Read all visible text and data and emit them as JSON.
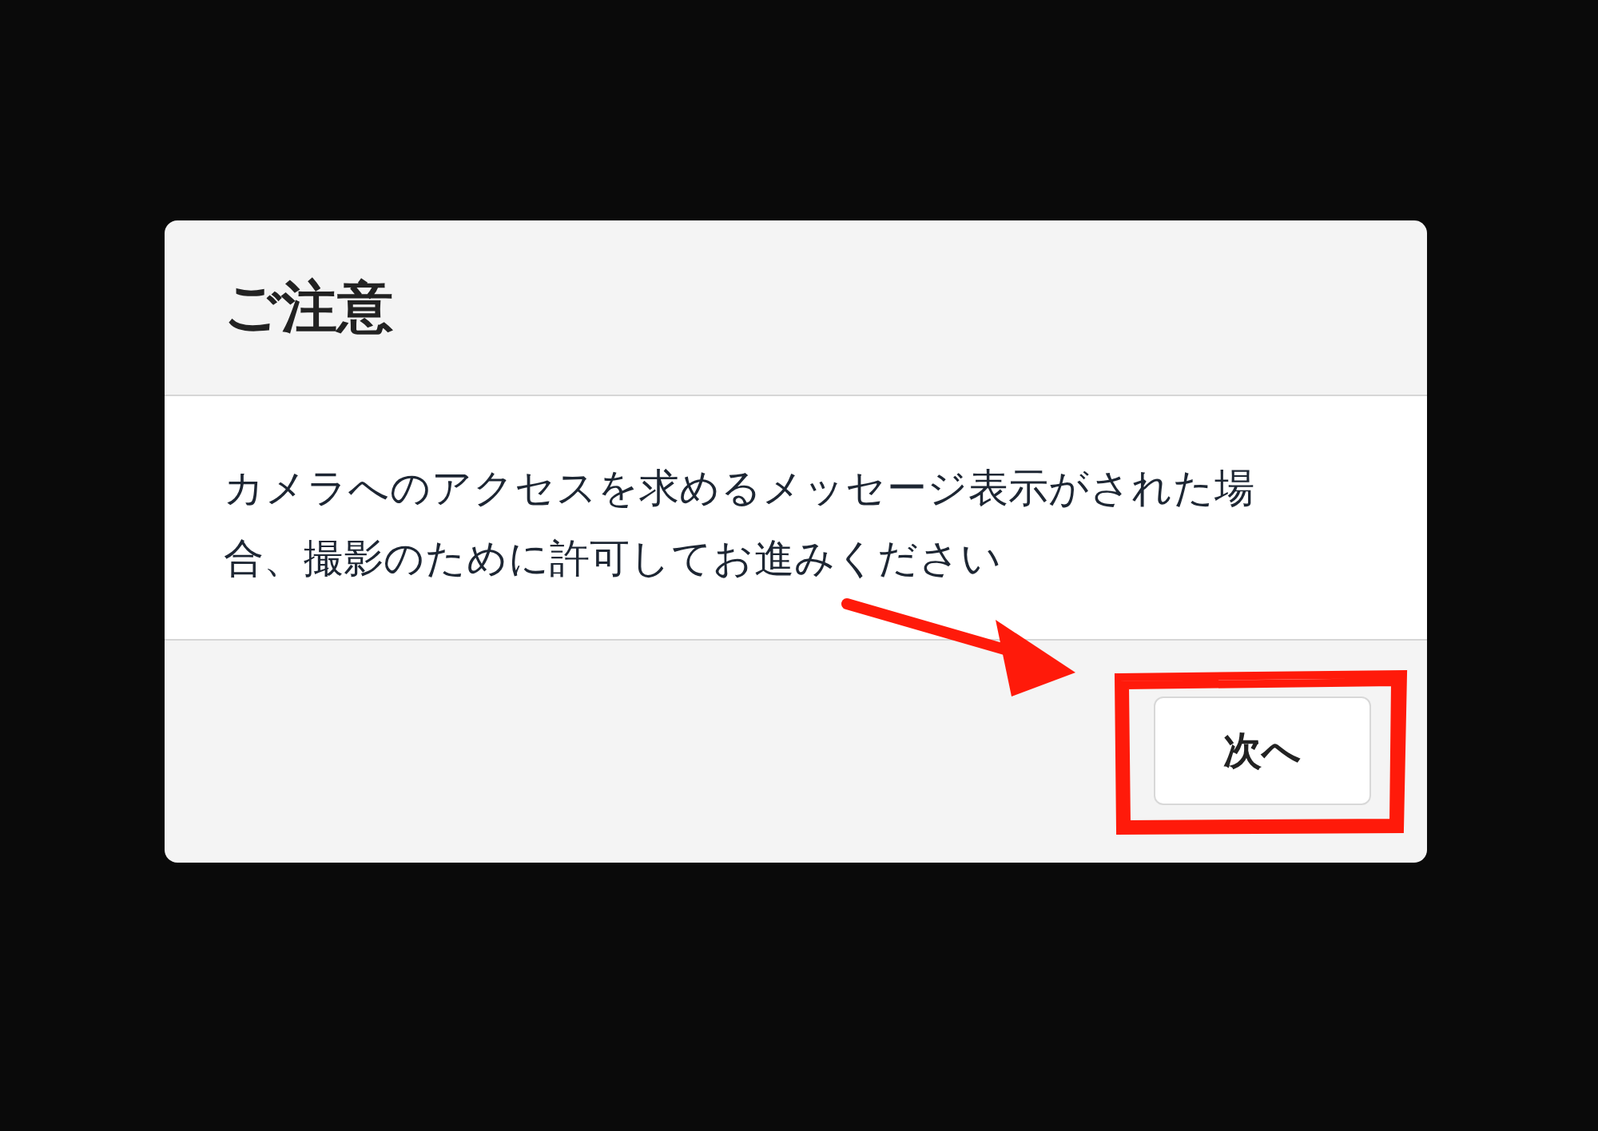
{
  "dialog": {
    "title": "ご注意",
    "message": "カメラへのアクセスを求めるメッセージ表示がされた場合、撮影のために許可してお進みください",
    "buttons": [
      "次へ"
    ]
  },
  "annotations": {
    "arrow": true,
    "highlight_frame": true
  }
}
